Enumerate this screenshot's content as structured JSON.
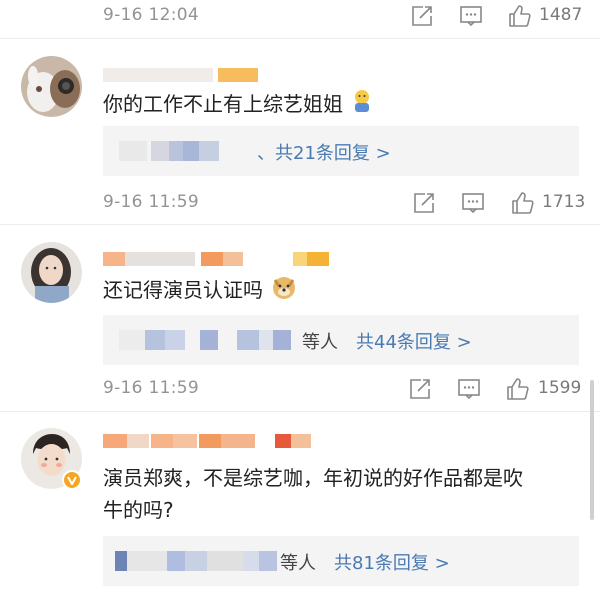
{
  "colors": {
    "reply_link": "#4a7ab0",
    "timestamp": "#939393",
    "reply_bg": "#f4f4f4",
    "verified_badge": "#f5a623"
  },
  "meta_rows": [
    {
      "time": "9-16 12:04",
      "likes": "1487",
      "icons": [
        "share-icon",
        "comment-icon",
        "like-icon"
      ]
    },
    {
      "time": "9-16 11:59",
      "likes": "1713",
      "icons": [
        "share-icon",
        "comment-icon",
        "like-icon"
      ]
    },
    {
      "time": "9-16 11:59",
      "likes": "1599",
      "icons": [
        "share-icon",
        "comment-icon",
        "like-icon"
      ]
    }
  ],
  "comments": [
    {
      "text": "你的工作不止有上综艺姐姐",
      "emoji": "shrug-emoji",
      "reply_summary": "、共21条回复 >"
    },
    {
      "text": "还记得演员认证吗",
      "emoji": "doge-emoji",
      "reply_others": "等人",
      "reply_summary": "共44条回复 >"
    },
    {
      "text_line1": "演员郑爽，不是综艺咖，年初说的好作品都是吹",
      "text_line2": "牛的吗?",
      "badge": "verified-badge",
      "reply_others": "等人",
      "reply_summary": "共81条回复 >"
    }
  ]
}
